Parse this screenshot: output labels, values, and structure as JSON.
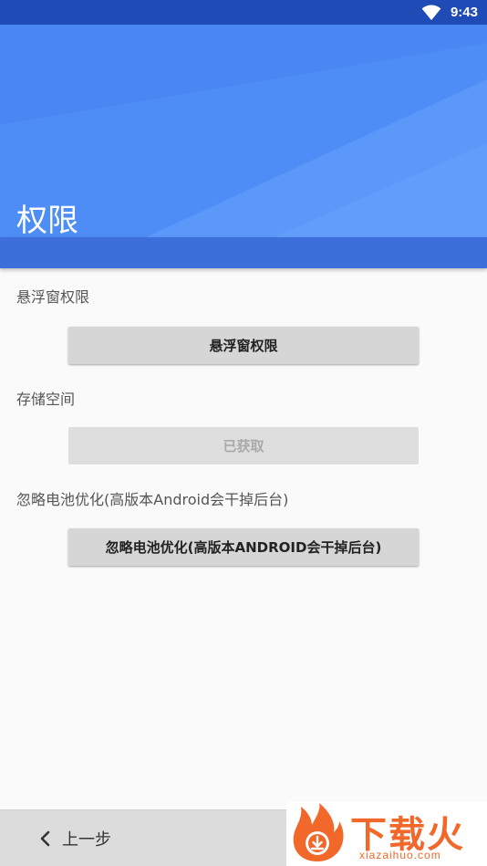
{
  "status_bar": {
    "time": "9:43",
    "wifi_icon": "wifi-icon"
  },
  "header": {
    "title": "权限",
    "color": "#4e8df6"
  },
  "sections": [
    {
      "label": "悬浮窗权限",
      "button_label": "悬浮窗权限",
      "enabled": true
    },
    {
      "label": "存储空间",
      "button_label": "已获取",
      "enabled": false
    },
    {
      "label": "忽略电池优化(高版本Android会干掉后台)",
      "button_label": "忽略电池优化(高版本ANDROID会干掉后台)",
      "enabled": true
    }
  ],
  "bottom_bar": {
    "back_label": "上一步",
    "back_icon": "chevron-left-icon"
  },
  "watermark": {
    "text": "下载火",
    "url": "xiazaihuo.com",
    "color": "#f2672a"
  }
}
